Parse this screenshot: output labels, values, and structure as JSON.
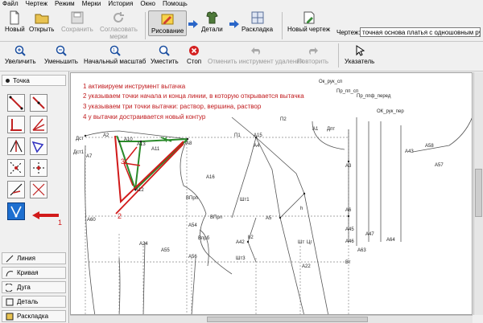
{
  "menu": [
    "Файл",
    "Чертеж",
    "Режим",
    "Мерки",
    "История",
    "Окно",
    "Помощь"
  ],
  "toolbar1": {
    "new": "Новый",
    "open": "Открыть",
    "save": "Сохранить",
    "agree_line1": "Согласовать",
    "agree_line2": "мерки",
    "drawing": "Рисование",
    "details": "Детали",
    "layout": "Раскладка",
    "new_drawing": "Новый чертеж",
    "drawing_label": "Чертеж:",
    "drawing_value": "точная основа платья с одношовным ру"
  },
  "toolbar2": {
    "zoom_in": "Увеличить",
    "zoom_out": "Уменьшить",
    "initial_scale": "Начальный масштаб",
    "fit": "Уместить",
    "stop": "Стоп",
    "undo": "Отменить инструмент удаления",
    "redo": "Повторить",
    "pointer": "Указатель"
  },
  "left": {
    "tochka": "Точка",
    "categories": [
      "Линия",
      "Кривая",
      "Дуга",
      "Деталь",
      "Раскладка"
    ],
    "arrow_number": "1"
  },
  "instructions": [
    "1 активируем инструмент вытачка",
    "2 указываем точки начала и конца линии, в которую открывается вытачка",
    "3 указываем три точки вытачки: раствор, вершина, раствор",
    "4 у вытачки достраивается новый контур"
  ],
  "annotations": {
    "n2": "2",
    "n3": "3",
    "n4": "4"
  },
  "points": {
    "dst": "Дст",
    "dst1": "Дст1",
    "a7": "А7",
    "a2": "А2",
    "a13": "А13",
    "a11": "А11",
    "a10": "А10",
    "a12": "А12",
    "a8": "А8",
    "a16": "А16",
    "a60": "А60",
    "a24": "А24",
    "a55": "А55",
    "a56": "А56",
    "a54": "А54",
    "vprp": "ВПрп",
    "vprb": "Впрб",
    "vpl": "ВПрл",
    "a42": "А42",
    "sht1": "Шт1",
    "sht": "Шт",
    "sht3": "Шт3",
    "a3": "А3",
    "a1": "А1",
    "dpt": "Дпт",
    "p1": "П1",
    "p2": "П2",
    "a15": "А15",
    "a4": "А4",
    "a5": "А5",
    "h": "h",
    "h2": "h2",
    "a6": "А6",
    "a45": "А45",
    "a46": "А46",
    "a63": "А63",
    "a47": "А47",
    "a64": "А64",
    "a22": "А22",
    "vt": "Вт",
    "cg": "Цг",
    "ok_ruk_sp": "Ок_рук_сп",
    "pr_pp_sp": "Пр_пп_сп",
    "pr_ppf_pered": "Пр_ппф_перед",
    "ok_ruk_per": "ОК_рук_пер",
    "a43": "А43",
    "a58": "А58",
    "a57": "А57"
  },
  "colors": {
    "instruction_red": "#c0191c",
    "dart_green": "#2a8a2a",
    "dart_red": "#d11a1a",
    "selected_tool": "#1d6fd0"
  }
}
